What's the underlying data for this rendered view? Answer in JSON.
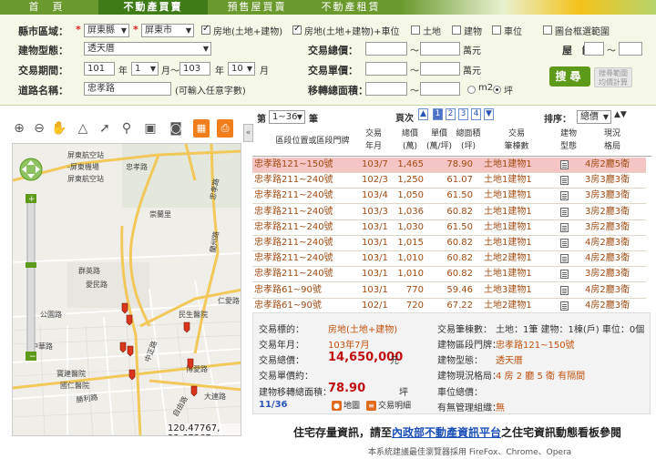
{
  "nav": {
    "tabs": [
      "首　頁",
      "不動產買賣",
      "預售屋買賣",
      "不動產租賃"
    ],
    "active": 1
  },
  "search": {
    "county_label": "縣市區域：",
    "county_value": "屏東縣",
    "town_value": "屏東市",
    "type_options": [
      {
        "label": "房地(土地+建物)",
        "checked": true
      },
      {
        "label": "房地(土地+建物)+車位",
        "checked": true
      },
      {
        "label": "土地",
        "checked": false
      },
      {
        "label": "建物",
        "checked": false
      },
      {
        "label": "車位",
        "checked": false
      }
    ],
    "map_range_label": "圖台框選範圍",
    "building_type_label": "建物型態：",
    "building_type_value": "透天厝",
    "total_price_label": "交易總價：",
    "total_price_unit": "萬元",
    "age_label": "屋　齡：",
    "period_label": "交易期間：",
    "period_start_year": "101",
    "period_start_month": "1",
    "period_end_year": "103",
    "period_end_month": "10",
    "month_label": "月",
    "month_sep": "月～",
    "year_label": "年",
    "unit_price_label": "交易單價：",
    "unit_price_unit": "萬元",
    "road_label": "道路名稱：",
    "road_value": "忠孝路",
    "road_hint": "(可輸入任意字數)",
    "area_label": "移轉總面積：",
    "area_unit_m2": "m2",
    "area_unit_ping": "坪",
    "tilde": "～",
    "search_button": "搜尋",
    "calc_button_line1": "搜尋範圍",
    "calc_button_line2": "均價計算"
  },
  "map": {
    "labels": [
      "屏東航空站",
      "-屏東機場",
      "屏東航空站",
      "忠孝路",
      "忠孝路",
      "崇蘭里",
      "蘭州路",
      "群英路",
      "愛民路",
      "仁愛路",
      "公園路",
      "勝利路",
      "中正路",
      "自由路",
      "大連路",
      "博愛路",
      "民生醫院",
      "中華路",
      "寶建醫院",
      "國仁醫院"
    ],
    "coords": "120.47767, 22.67367",
    "collapse_icon": "«"
  },
  "results": {
    "page_label_prefix": "第",
    "page_range": "1~36",
    "page_label_suffix": "筆",
    "page_nav_label": "頁次",
    "pages": [
      "1",
      "2",
      "3",
      "4"
    ],
    "current_page": "1",
    "sort_label": "排序：",
    "sort_value": "總價",
    "headers": {
      "location": "區段位置或區段門牌",
      "trade_date": [
        "交易",
        "年月"
      ],
      "total": [
        "總價",
        "(萬)"
      ],
      "unit": [
        "單價",
        "(萬/坪)"
      ],
      "area": [
        "總面積",
        "(坪)"
      ],
      "target": [
        "交易",
        "筆棟數"
      ],
      "btype": [
        "建物",
        "型態"
      ],
      "layout": [
        "現況",
        "格局"
      ]
    },
    "rows": [
      {
        "addr": "忠孝路121~150號",
        "date": "103/7",
        "total": "1,465",
        "unit": "",
        "area": "78.90",
        "target": "土地1建物1",
        "layout": "4房2廳5衛",
        "selected": true
      },
      {
        "addr": "忠孝路211~240號",
        "date": "102/3",
        "total": "1,250",
        "unit": "",
        "area": "61.07",
        "target": "土地1建物1",
        "layout": "3房3廳3衛",
        "selected": false
      },
      {
        "addr": "忠孝路211~240號",
        "date": "103/4",
        "total": "1,050",
        "unit": "",
        "area": "61.50",
        "target": "土地1建物1",
        "layout": "3房3廳3衛",
        "selected": false
      },
      {
        "addr": "忠孝路211~240號",
        "date": "103/3",
        "total": "1,036",
        "unit": "",
        "area": "60.82",
        "target": "土地1建物1",
        "layout": "3房2廳3衛",
        "selected": false
      },
      {
        "addr": "忠孝路211~240號",
        "date": "103/1",
        "total": "1,030",
        "unit": "",
        "area": "61.50",
        "target": "土地1建物1",
        "layout": "3房2廳3衛",
        "selected": false
      },
      {
        "addr": "忠孝路211~240號",
        "date": "103/1",
        "total": "1,015",
        "unit": "",
        "area": "60.82",
        "target": "土地1建物1",
        "layout": "4房2廳3衛",
        "selected": false
      },
      {
        "addr": "忠孝路211~240號",
        "date": "103/1",
        "total": "1,010",
        "unit": "",
        "area": "60.82",
        "target": "土地2建物1",
        "layout": "4房2廳3衛",
        "selected": false
      },
      {
        "addr": "忠孝路211~240號",
        "date": "103/1",
        "total": "1,010",
        "unit": "",
        "area": "60.82",
        "target": "土地1建物1",
        "layout": "3房2廳3衛",
        "selected": false
      },
      {
        "addr": "忠孝路61~90號",
        "date": "103/1",
        "total": "770",
        "unit": "",
        "area": "59.46",
        "target": "土地3建物1",
        "layout": "4房2廳3衛",
        "selected": false
      },
      {
        "addr": "忠孝路61~90號",
        "date": "102/1",
        "total": "720",
        "unit": "",
        "area": "67.22",
        "target": "土地2建物1",
        "layout": "4房2廳3衛",
        "selected": false
      }
    ]
  },
  "detail": {
    "target_label": "交易標的：",
    "target_value": "房地(土地+建物)",
    "date_label": "交易年月：",
    "date_value": "103年7月",
    "total_label": "交易總價：",
    "total_value": "14,650,000",
    "total_unit": "元",
    "unit_label": "交易單價約：",
    "area_label": "建物移轉總面積：",
    "area_value": "78.90",
    "area_unit": "坪",
    "counter": "11/36",
    "map_btn": "地圖",
    "detail_btn": "交易明細",
    "count_label": "交易筆棟數：",
    "count_value": "土地：1筆 建物：1棟(戶) 車位：0個",
    "addr_label": "建物區段門牌：",
    "addr_value": "忠孝路121~150號",
    "btype_label": "建物型態：",
    "btype_value": "透天厝",
    "layout_label": "建物現況格局：",
    "layout_value": "4 房 2 廳 5 衛 有隔間",
    "parking_label": "車位總價：",
    "mgmt_label": "有無管理組織：",
    "mgmt_value": "無"
  },
  "footer": {
    "text_prefix": "住宅存量資訊，請至",
    "link": "內政部不動產資訊平台",
    "text_suffix": "之住宅資訊動態看板參閱",
    "note": "本系統建議最佳瀏覽器採用 FireFox、Chrome、Opera"
  },
  "colors": {
    "nav_green": "#6a9a2e",
    "panel_bg": "#f5f8e7",
    "result_text": "#a04b12",
    "selected_row": "#f5c4c4",
    "price_red": "#c01010",
    "search_btn": "#5d9a1a",
    "marker_red": "#d9341c"
  }
}
